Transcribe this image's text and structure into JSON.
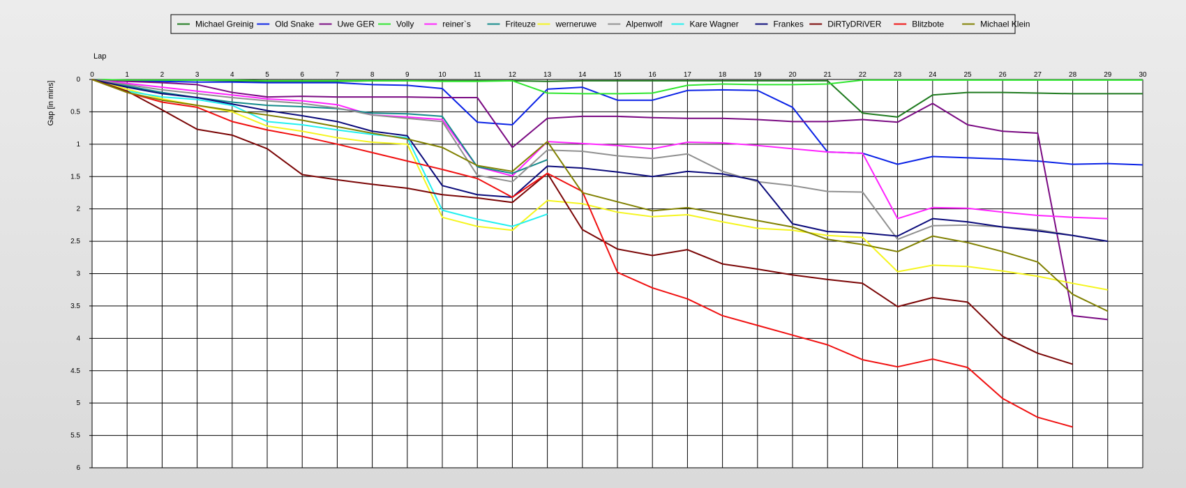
{
  "chart_data": {
    "type": "line",
    "title": "",
    "xlabel": "Lap",
    "ylabel": "Gap [in mins]",
    "xlim": [
      0,
      30
    ],
    "ylim": [
      0,
      6
    ],
    "y_inverted": true,
    "grid": true,
    "legend_position": "top",
    "x_ticks": [
      0,
      1,
      2,
      3,
      4,
      5,
      6,
      7,
      8,
      9,
      10,
      11,
      12,
      13,
      14,
      15,
      16,
      17,
      18,
      19,
      20,
      21,
      22,
      23,
      24,
      25,
      26,
      27,
      28,
      29,
      30
    ],
    "y_ticks": [
      {
        "value": 0,
        "label": "0"
      },
      {
        "value": 0.5,
        "label": "0.5"
      },
      {
        "value": 1,
        "label": "1"
      },
      {
        "value": 1.5,
        "label": "1.5"
      },
      {
        "value": 2,
        "label": "2"
      },
      {
        "value": 2.5,
        "label": "2.5"
      },
      {
        "value": 3,
        "label": "3"
      },
      {
        "value": 3.5,
        "label": "3.5"
      },
      {
        "value": 4,
        "label": "4"
      },
      {
        "value": 4.5,
        "label": "4.5"
      },
      {
        "value": 5,
        "label": "5"
      },
      {
        "value": 5.5,
        "label": "5.5"
      },
      {
        "value": 6,
        "label": "6"
      }
    ],
    "series": [
      {
        "name": "Michael Greinig",
        "color": "#1e7a1e",
        "values": [
          0,
          0.01,
          0.01,
          0.01,
          0.02,
          0.03,
          0.03,
          0.03,
          0.02,
          0.02,
          0.02,
          0.02,
          0.02,
          0.03,
          0.02,
          0.02,
          0.02,
          0.02,
          0.02,
          0.02,
          0.02,
          0.02,
          0.52,
          0.58,
          0.24,
          0.2,
          0.2,
          0.21,
          0.22,
          0.22,
          0.22
        ]
      },
      {
        "name": "Old Snake",
        "color": "#0a22e6",
        "values": [
          0,
          0.02,
          0.03,
          0.04,
          0.04,
          0.05,
          0.05,
          0.05,
          0.08,
          0.09,
          0.14,
          0.66,
          0.7,
          0.15,
          0.12,
          0.32,
          0.32,
          0.17,
          0.16,
          0.17,
          0.43,
          1.12,
          1.14,
          1.31,
          1.19,
          1.21,
          1.23,
          1.26,
          1.31,
          1.3,
          1.32
        ]
      },
      {
        "name": "Uwe GER",
        "color": "#7a0a82",
        "values": [
          0,
          0.03,
          0.05,
          0.08,
          0.2,
          0.27,
          0.26,
          0.27,
          0.27,
          0.27,
          0.28,
          0.28,
          1.05,
          0.6,
          0.57,
          0.57,
          0.59,
          0.6,
          0.6,
          0.62,
          0.65,
          0.65,
          0.62,
          0.66,
          0.37,
          0.7,
          0.8,
          0.83,
          3.65,
          3.71
        ]
      },
      {
        "name": "Volly",
        "color": "#2ee62e",
        "values": [
          0,
          0.01,
          0.01,
          0.01,
          0.01,
          0.02,
          0.02,
          0.02,
          0.02,
          0.02,
          0.03,
          0.03,
          0.02,
          0.21,
          0.22,
          0.22,
          0.21,
          0.09,
          0.07,
          0.08,
          0.08,
          0.07,
          0.01,
          0.01,
          0.01,
          0.01,
          0.01,
          0.01,
          0.01,
          0.01,
          0.01
        ]
      },
      {
        "name": "reiner`s",
        "color": "#ff22ff",
        "values": [
          0,
          0.06,
          0.12,
          0.18,
          0.24,
          0.3,
          0.33,
          0.39,
          0.55,
          0.58,
          0.62,
          1.35,
          1.49,
          0.96,
          0.99,
          1.02,
          1.07,
          0.97,
          0.98,
          1.02,
          1.07,
          1.12,
          1.14,
          2.15,
          1.98,
          1.99,
          2.05,
          2.1,
          2.13,
          2.15
        ]
      },
      {
        "name": "Friteuze",
        "color": "#138a8a",
        "values": [
          0,
          0.1,
          0.2,
          0.28,
          0.35,
          0.4,
          0.42,
          0.45,
          0.52,
          0.53,
          0.57,
          1.35,
          1.45,
          1.24
        ]
      },
      {
        "name": "werneruwe",
        "color": "#f5f51e",
        "values": [
          0,
          0.15,
          0.3,
          0.4,
          0.5,
          0.72,
          0.8,
          0.9,
          0.97,
          1.0,
          2.13,
          2.27,
          2.33,
          1.87,
          1.92,
          2.05,
          2.12,
          2.09,
          2.2,
          2.3,
          2.33,
          2.41,
          2.44,
          2.97,
          2.87,
          2.89,
          2.96,
          3.04,
          3.15,
          3.25
        ]
      },
      {
        "name": "Alpenwolf",
        "color": "#909090",
        "values": [
          0,
          0.08,
          0.16,
          0.22,
          0.28,
          0.33,
          0.37,
          0.44,
          0.55,
          0.6,
          0.65,
          1.48,
          1.58,
          1.09,
          1.11,
          1.18,
          1.22,
          1.15,
          1.42,
          1.58,
          1.64,
          1.73,
          1.74,
          2.47,
          2.26,
          2.25,
          2.28,
          2.32,
          2.41,
          2.5
        ]
      },
      {
        "name": "Kare Wagner",
        "color": "#22f0f0",
        "values": [
          0,
          0.18,
          0.27,
          0.31,
          0.4,
          0.65,
          0.7,
          0.78,
          0.85,
          0.9,
          2.02,
          2.16,
          2.27,
          2.08
        ]
      },
      {
        "name": "Frankes",
        "color": "#0a0a7a",
        "values": [
          0,
          0.12,
          0.22,
          0.28,
          0.38,
          0.48,
          0.56,
          0.65,
          0.8,
          0.87,
          1.64,
          1.78,
          1.82,
          1.34,
          1.37,
          1.43,
          1.5,
          1.42,
          1.46,
          1.56,
          2.23,
          2.35,
          2.37,
          2.42,
          2.15,
          2.2,
          2.28,
          2.34,
          2.41,
          2.5
        ]
      },
      {
        "name": "DiRTyDRiVER",
        "color": "#7a0505",
        "values": [
          0,
          0.18,
          0.47,
          0.77,
          0.86,
          1.07,
          1.47,
          1.55,
          1.62,
          1.68,
          1.78,
          1.83,
          1.9,
          1.45,
          2.32,
          2.62,
          2.72,
          2.63,
          2.85,
          2.93,
          3.02,
          3.09,
          3.15,
          3.51,
          3.37,
          3.44,
          3.97,
          4.23,
          4.4
        ]
      },
      {
        "name": "Blitzbote",
        "color": "#f01010",
        "values": [
          0,
          0.2,
          0.35,
          0.43,
          0.65,
          0.78,
          0.88,
          1.0,
          1.13,
          1.26,
          1.39,
          1.53,
          1.82,
          1.45,
          1.73,
          2.98,
          3.22,
          3.39,
          3.65,
          3.8,
          3.95,
          4.1,
          4.33,
          4.44,
          4.32,
          4.45,
          4.93,
          5.22,
          5.37
        ]
      },
      {
        "name": "Michael Klein",
        "color": "#808000",
        "values": [
          0,
          0.2,
          0.32,
          0.4,
          0.48,
          0.55,
          0.63,
          0.73,
          0.83,
          0.92,
          1.05,
          1.33,
          1.42,
          0.96,
          1.75,
          1.89,
          2.03,
          1.98,
          2.08,
          2.18,
          2.28,
          2.47,
          2.55,
          2.66,
          2.42,
          2.52,
          2.66,
          2.82,
          3.32,
          3.58
        ]
      }
    ]
  }
}
